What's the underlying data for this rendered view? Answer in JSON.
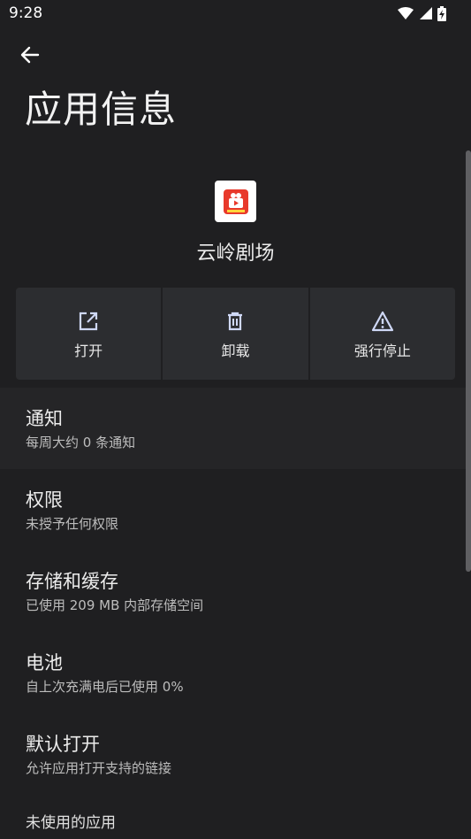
{
  "status_bar": {
    "time": "9:28",
    "icons": [
      "wifi-icon",
      "cell-signal-icon",
      "battery-charging-icon"
    ]
  },
  "header": {
    "back_icon": "arrow-left-icon",
    "title": "应用信息"
  },
  "app": {
    "name": "云岭剧场",
    "icon_text": "云岭剧场",
    "icon_color": "#e8392b"
  },
  "actions": [
    {
      "label": "打开",
      "icon": "open-external-icon"
    },
    {
      "label": "卸载",
      "icon": "trash-icon"
    },
    {
      "label": "强行停止",
      "icon": "warning-icon"
    }
  ],
  "settings": [
    {
      "title": "通知",
      "summary": "每周大约 0 条通知"
    },
    {
      "title": "权限",
      "summary": "未授予任何权限"
    },
    {
      "title": "存储和缓存",
      "summary": "已使用 209 MB 内部存储空间"
    },
    {
      "title": "电池",
      "summary": "自上次充满电后已使用 0%"
    },
    {
      "title": "默认打开",
      "summary": "允许应用打开支持的链接"
    },
    {
      "title": "未使用的应用",
      "summary": ""
    }
  ],
  "colors": {
    "background": "#1f1f21",
    "card": "#2c2d30",
    "accent_icon": "#cfd8f6"
  }
}
